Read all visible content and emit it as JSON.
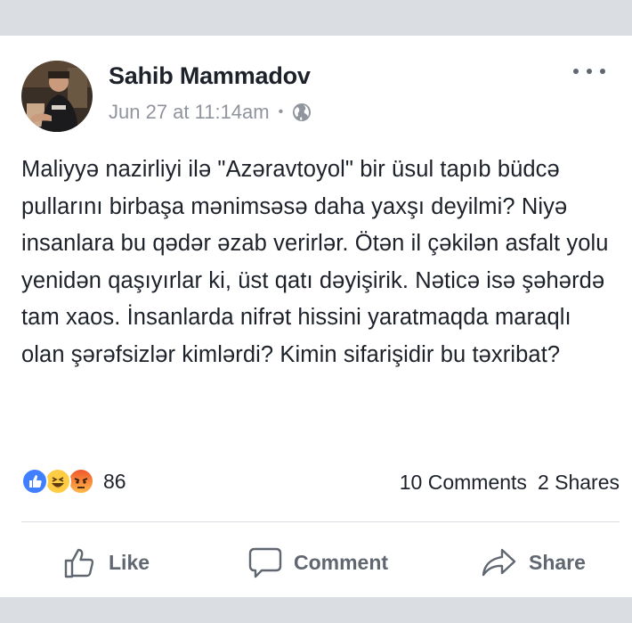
{
  "post": {
    "author": "Sahib Mammadov",
    "timestamp": "Jun 27 at 11:14am",
    "separator": "•",
    "privacy_icon": "globe-icon",
    "text": "Maliyyə nazirliyi ilə \"Azəravtoyol\" bir üsul tapıb büdcə pullarını birbaşa mənimsəsə daha yaxşı deyilmi? Niyə insanlara bu qədər əzab verirlər. Ötən il çəkilən asfalt yolu yenidən qaşıyırlar ki, üst qatı dəyişirik. Nəticə isə şəhərdə tam xaos. İnsanlarda nifrət hissini yaratmaqda maraqlı olan şərəfsizlər kimlərdi? Kimin sifarişidir bu təxribat?"
  },
  "reactions": {
    "icons": [
      "like-icon",
      "haha-icon",
      "angry-icon"
    ],
    "count": "86"
  },
  "stats": {
    "comments": "10 Comments",
    "shares": "2 Shares"
  },
  "actions": {
    "like": "Like",
    "comment": "Comment",
    "share": "Share"
  },
  "colors": {
    "like_blue": "#4080ff",
    "haha_yellow": "#ffcd44",
    "angry_red": "#f0572b",
    "muted_text": "#606770",
    "meta_text": "#90949c"
  }
}
